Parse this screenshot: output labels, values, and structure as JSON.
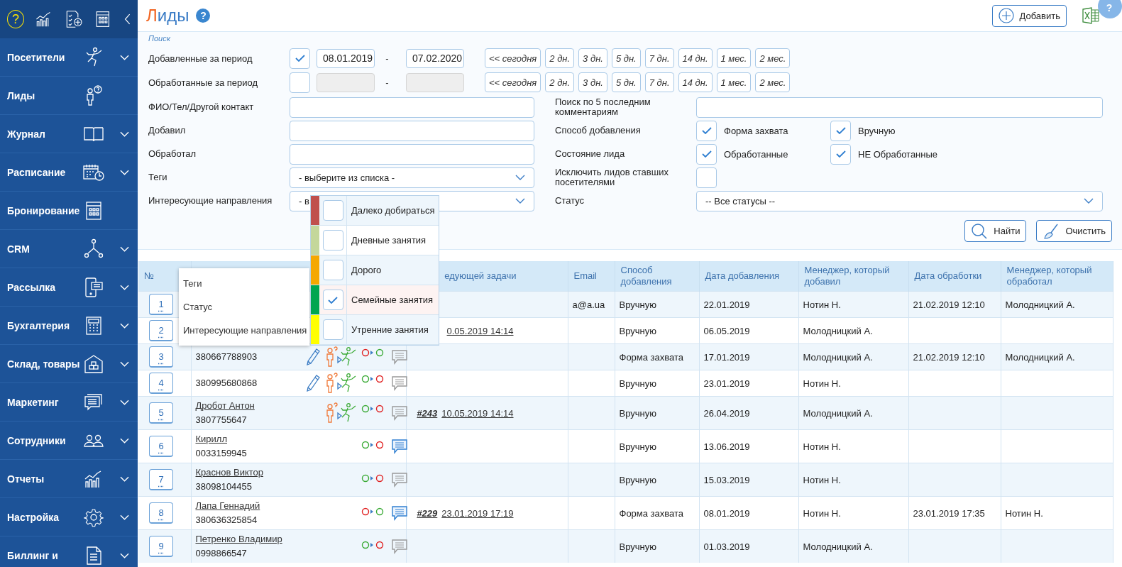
{
  "sidebar": {
    "help": "?",
    "items": [
      {
        "label": "Посетители",
        "expandable": true
      },
      {
        "label": "Лиды",
        "expandable": false
      },
      {
        "label": "Журнал",
        "expandable": true
      },
      {
        "label": "Расписание",
        "expandable": true
      },
      {
        "label": "Бронирование",
        "expandable": false
      },
      {
        "label": "CRM",
        "expandable": true
      },
      {
        "label": "Рассылка",
        "expandable": true
      },
      {
        "label": "Бухгалтерия",
        "expandable": true
      },
      {
        "label": "Склад, товары",
        "expandable": true
      },
      {
        "label": "Маркетинг",
        "expandable": true
      },
      {
        "label": "Сотрудники",
        "expandable": true
      },
      {
        "label": "Отчеты",
        "expandable": true
      },
      {
        "label": "Настройка",
        "expandable": true
      },
      {
        "label": "Биллинг и",
        "expandable": true
      }
    ]
  },
  "header": {
    "title": "Лиды",
    "help": "?",
    "add_button": "Добавить",
    "corner_help": "?"
  },
  "search": {
    "title": "Поиск",
    "periods": [
      {
        "label": "Добавленные за период",
        "checked": true,
        "from": "08.01.2019",
        "dash": "-",
        "to": "07.02.2020",
        "quick_ranges": [
          "<< сегодня",
          "2 дн.",
          "3 дн.",
          "5 дн.",
          "7 дн.",
          "14 дн.",
          "1 мес.",
          "2 мес."
        ]
      },
      {
        "label": "Обработанные за период",
        "checked": false,
        "dash": "-",
        "quick_ranges": [
          "<< сегодня",
          "2 дн.",
          "3 дн.",
          "5 дн.",
          "7 дн.",
          "14 дн.",
          "1 мес.",
          "2 мес."
        ]
      }
    ],
    "rows": [
      {
        "left": {
          "label": "ФИО/Тел/Другой контакт",
          "kind": "text"
        },
        "right": {
          "label": "Поиск по 5 последним комментариям",
          "kind": "text"
        }
      },
      {
        "left": {
          "label": "Добавил",
          "kind": "text"
        },
        "right": {
          "label": "Способ добавления",
          "kind": "checks",
          "options": [
            {
              "label": "Форма захвата",
              "checked": true
            },
            {
              "label": "Вручную",
              "checked": true
            }
          ]
        }
      },
      {
        "left": {
          "label": "Обработал",
          "kind": "text"
        },
        "right": {
          "label": "Состояние лида",
          "kind": "checks",
          "options": [
            {
              "label": "Обработанные",
              "checked": true
            },
            {
              "label": "НЕ Обработанные",
              "checked": true
            }
          ]
        }
      },
      {
        "left": {
          "label": "Теги",
          "kind": "select",
          "value": "- выберите из списка -"
        },
        "right": {
          "label": "Исключить лидов ставших посетителями",
          "kind": "checks",
          "options": [
            {
              "checked": false
            }
          ]
        }
      },
      {
        "left": {
          "label": "Интересующие направления",
          "kind": "select",
          "value": "- в"
        },
        "right": {
          "label": "Статус",
          "kind": "select",
          "value": "-- Все статусы --"
        }
      }
    ],
    "buttons": [
      {
        "label": "Найти",
        "kind": "search"
      },
      {
        "label": "Очистить",
        "kind": "clear"
      }
    ]
  },
  "context_menu": {
    "items": [
      "Теги",
      "Статус",
      "Интересующие направления"
    ]
  },
  "directions_dropdown": {
    "items": [
      {
        "label": "Далеко добираться",
        "color": "#c0504d",
        "checked": false
      },
      {
        "label": "Дневные занятия",
        "color": "#c4d79b",
        "checked": false
      },
      {
        "label": "Дорого",
        "color": "#f5a800",
        "checked": false
      },
      {
        "label": "Семейные занятия",
        "color": "#00a650",
        "checked": true
      },
      {
        "label": "Утренние занятия",
        "color": "#ffff00",
        "checked": false
      }
    ]
  },
  "table": {
    "columns": [
      "№",
      "едующей задачи",
      "Email",
      "Способ добавления",
      "Дата добавления",
      "Менеджер, который добавил",
      "Дата обработки",
      "Менеджер, который обработал"
    ],
    "rows": [
      {
        "number": "1",
        "email": "a@a.ua",
        "method": "Вручную",
        "added": "22.01.2019",
        "added_by": "Нотин Н.",
        "processed_at": "21.02.2019 12:10",
        "processed_by": "Молодницкий А."
      },
      {
        "number": "2",
        "task": {
          "date": "0.05.2019 14:14"
        },
        "method": "Вручную",
        "added": "06.05.2019",
        "added_by": "Молодницкий А."
      },
      {
        "number": "3",
        "phone": "380667788903",
        "editable": true,
        "convertible": true,
        "processed": true,
        "comments": false,
        "method": "Форма захвата",
        "added": "17.01.2019",
        "added_by": "Молодницкий А.",
        "processed_at": "21.02.2019 12:10",
        "processed_by": "Молодницкий А."
      },
      {
        "number": "4",
        "phone": "380995680868",
        "editable": true,
        "convertible": true,
        "processed": false,
        "comments": false,
        "method": "Вручную",
        "added": "23.01.2019",
        "added_by": "Нотин Н."
      },
      {
        "number": "5",
        "name": "Дробот Антон",
        "phone": "3807755647",
        "editable": false,
        "convertible": true,
        "processed": false,
        "comments": false,
        "task": {
          "number": "#243",
          "date": "10.05.2019 14:14"
        },
        "method": "Вручную",
        "added": "26.04.2019",
        "added_by": "Молодницкий А."
      },
      {
        "number": "6",
        "name": "Кирилл",
        "phone": "0033159945",
        "editable": false,
        "convertible": false,
        "processed": false,
        "comments": true,
        "method": "Вручную",
        "added": "13.06.2019",
        "added_by": "Нотин Н."
      },
      {
        "number": "7",
        "name": "Краснов Виктор",
        "phone": "38098104455",
        "editable": false,
        "convertible": false,
        "processed": false,
        "comments": false,
        "method": "Вручную",
        "added": "15.03.2019",
        "added_by": "Нотин Н."
      },
      {
        "number": "8",
        "name": "Лапа Геннадий",
        "phone": "380636325854",
        "editable": false,
        "convertible": false,
        "processed": true,
        "comments": true,
        "task": {
          "number": "#229",
          "date": "23.01.2019 17:19"
        },
        "method": "Форма захвата",
        "added": "08.01.2019",
        "added_by": "Нотин Н.",
        "processed_at": "23.01.2019 17:35",
        "processed_by": "Нотин Н."
      },
      {
        "number": "9",
        "name": "Петренко Владимир",
        "phone": "0998866547",
        "editable": false,
        "convertible": false,
        "processed": false,
        "comments": false,
        "method": "Вручную",
        "added": "01.03.2019",
        "added_by": "Молодницкий А."
      }
    ]
  }
}
